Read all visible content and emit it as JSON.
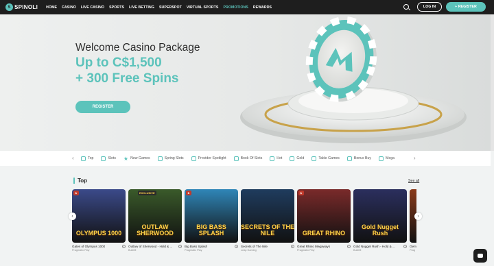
{
  "header": {
    "logo": "SPINOLI",
    "nav": [
      {
        "label": "HOME",
        "active": false
      },
      {
        "label": "CASINO",
        "active": false
      },
      {
        "label": "LIVE CASINO",
        "active": false
      },
      {
        "label": "SPORTS",
        "active": false
      },
      {
        "label": "LIVE BETTING",
        "active": false
      },
      {
        "label": "SUPERSPOT",
        "active": false
      },
      {
        "label": "VIRTUAL SPORTS",
        "active": false
      },
      {
        "label": "PROMOTIONS",
        "active": true
      },
      {
        "label": "REWARDS",
        "active": false
      }
    ],
    "login_label": "LOG IN",
    "register_label": "+ REGISTER",
    "search_icon": "search-icon"
  },
  "hero": {
    "title": "Welcome Casino Package",
    "amount": "Up to C$1,500",
    "spins": "+ 300 Free Spins",
    "cta": "REGISTER"
  },
  "categories": [
    {
      "label": "Top",
      "icon": "trophy-icon"
    },
    {
      "label": "Slots",
      "icon": "slot-icon"
    },
    {
      "label": "New Games",
      "icon": "star-icon"
    },
    {
      "label": "Spring Slots",
      "icon": "flower-icon"
    },
    {
      "label": "Provider Spotlight",
      "icon": "spotlight-icon"
    },
    {
      "label": "Book Of Slots",
      "icon": "book-icon"
    },
    {
      "label": "Hot",
      "icon": "fire-icon"
    },
    {
      "label": "Gold",
      "icon": "gold-icon"
    },
    {
      "label": "Table Games",
      "icon": "table-icon"
    },
    {
      "label": "Bonus Buy",
      "icon": "bonus-icon"
    },
    {
      "label": "Mega",
      "icon": "mega-icon"
    }
  ],
  "section": {
    "title": "Top",
    "see_all": "See all"
  },
  "games": [
    {
      "name": "Gates of Olympus 1000",
      "provider": "Pragmatic Play",
      "art": "OLYMPUS 1000",
      "bg": "#3b4a8a",
      "drops": true,
      "exclusive": false
    },
    {
      "name": "Outlaw of Sherwood - Hold & ...",
      "provider": "Bulletfi",
      "art": "OUTLAW SHERWOOD",
      "bg": "#3a5a2a",
      "drops": false,
      "exclusive": true
    },
    {
      "name": "Big Bass Splash",
      "provider": "Pragmatic Play",
      "art": "BIG BASS SPLASH",
      "bg": "#2f86b8",
      "drops": true,
      "exclusive": false
    },
    {
      "name": "Secrets of The Nile",
      "provider": "Leap Gaming",
      "art": "SECRETS OF THE NILE",
      "bg": "#1f3c5e",
      "drops": false,
      "exclusive": false
    },
    {
      "name": "Great Rhino Megaways",
      "provider": "Pragmatic Play",
      "art": "GREAT RHINO",
      "bg": "#7a2a2a",
      "drops": true,
      "exclusive": false
    },
    {
      "name": "Gold Nugget Rush - Hold & ...",
      "provider": "Bulletfi",
      "art": "Gold Nugget Rush",
      "bg": "#2b2f5e",
      "drops": false,
      "exclusive": false
    },
    {
      "name": "Gem",
      "provider": "Prag",
      "art": "",
      "bg": "#8a3a1a",
      "drops": false,
      "exclusive": false
    }
  ],
  "colors": {
    "accent": "#5cc3bb",
    "header_bg": "#1e1e1e"
  }
}
